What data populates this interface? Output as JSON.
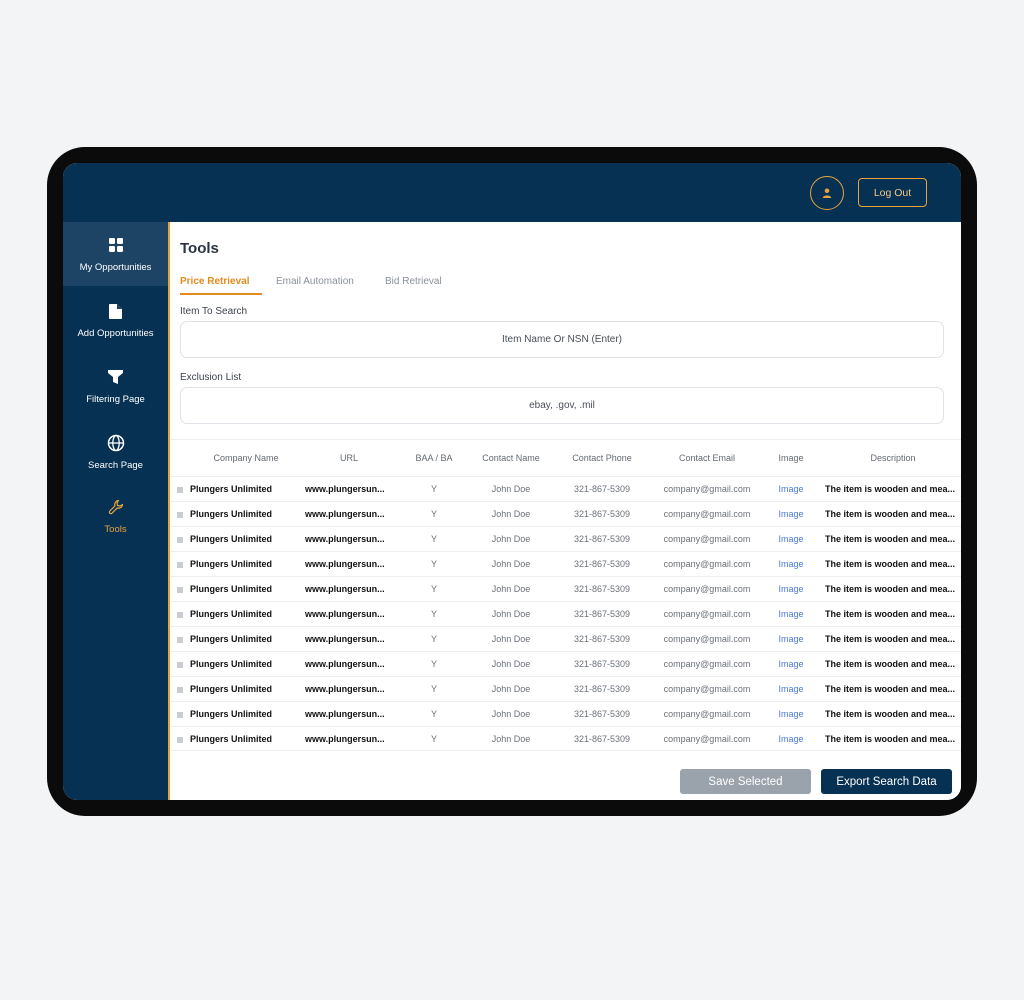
{
  "header": {
    "logout_label": "Log Out",
    "avatar_icon": "user-icon"
  },
  "sidebar": {
    "items": [
      {
        "label": "My Opportunities",
        "icon": "grid-icon"
      },
      {
        "label": "Add Opportunities",
        "icon": "document-icon"
      },
      {
        "label": "Filtering Page",
        "icon": "funnel-icon"
      },
      {
        "label": "Search Page",
        "icon": "globe-icon"
      },
      {
        "label": "Tools",
        "icon": "wrench-icon"
      }
    ]
  },
  "main": {
    "title": "Tools",
    "tabs": [
      {
        "label": "Price Retrieval"
      },
      {
        "label": "Email  Automation"
      },
      {
        "label": "Bid Retrieval"
      }
    ],
    "item_search": {
      "label": "Item To Search",
      "placeholder": "Item Name Or NSN (Enter)"
    },
    "exclusion": {
      "label": "Exclusion List",
      "value": "ebay, .gov, .mil"
    }
  },
  "table": {
    "headers": [
      "Company Name",
      "URL",
      "BAA / BA",
      "Contact Name",
      "Contact Phone",
      "Contact Email",
      "Image",
      "Description"
    ],
    "rows": [
      [
        "Plungers Unlimited",
        "www.plungersun...",
        "Y",
        "John Doe",
        "321-867-5309",
        "company@gmail.com",
        "Image",
        "The item is wooden and mea..."
      ],
      [
        "Plungers Unlimited",
        "www.plungersun...",
        "Y",
        "John Doe",
        "321-867-5309",
        "company@gmail.com",
        "Image",
        "The item is wooden and mea..."
      ],
      [
        "Plungers Unlimited",
        "www.plungersun...",
        "Y",
        "John Doe",
        "321-867-5309",
        "company@gmail.com",
        "Image",
        "The item is wooden and mea..."
      ],
      [
        "Plungers Unlimited",
        "www.plungersun...",
        "Y",
        "John Doe",
        "321-867-5309",
        "company@gmail.com",
        "Image",
        "The item is wooden and mea..."
      ],
      [
        "Plungers Unlimited",
        "www.plungersun...",
        "Y",
        "John Doe",
        "321-867-5309",
        "company@gmail.com",
        "Image",
        "The item is wooden and mea..."
      ],
      [
        "Plungers Unlimited",
        "www.plungersun...",
        "Y",
        "John Doe",
        "321-867-5309",
        "company@gmail.com",
        "Image",
        "The item is wooden and mea..."
      ],
      [
        "Plungers Unlimited",
        "www.plungersun...",
        "Y",
        "John Doe",
        "321-867-5309",
        "company@gmail.com",
        "Image",
        "The item is wooden and mea..."
      ],
      [
        "Plungers Unlimited",
        "www.plungersun...",
        "Y",
        "John Doe",
        "321-867-5309",
        "company@gmail.com",
        "Image",
        "The item is wooden and mea..."
      ],
      [
        "Plungers Unlimited",
        "www.plungersun...",
        "Y",
        "John Doe",
        "321-867-5309",
        "company@gmail.com",
        "Image",
        "The item is wooden and mea..."
      ],
      [
        "Plungers Unlimited",
        "www.plungersun...",
        "Y",
        "John Doe",
        "321-867-5309",
        "company@gmail.com",
        "Image",
        "The item is wooden and mea..."
      ],
      [
        "Plungers Unlimited",
        "www.plungersun...",
        "Y",
        "John Doe",
        "321-867-5309",
        "company@gmail.com",
        "Image",
        "The item is wooden and mea..."
      ]
    ]
  },
  "actions": {
    "save_label": "Save Selected",
    "export_label": "Export Search Data"
  },
  "colors": {
    "navy": "#073153",
    "accent": "#e9a23b",
    "link": "#4a78d8",
    "disabled": "#9aa2ab"
  }
}
